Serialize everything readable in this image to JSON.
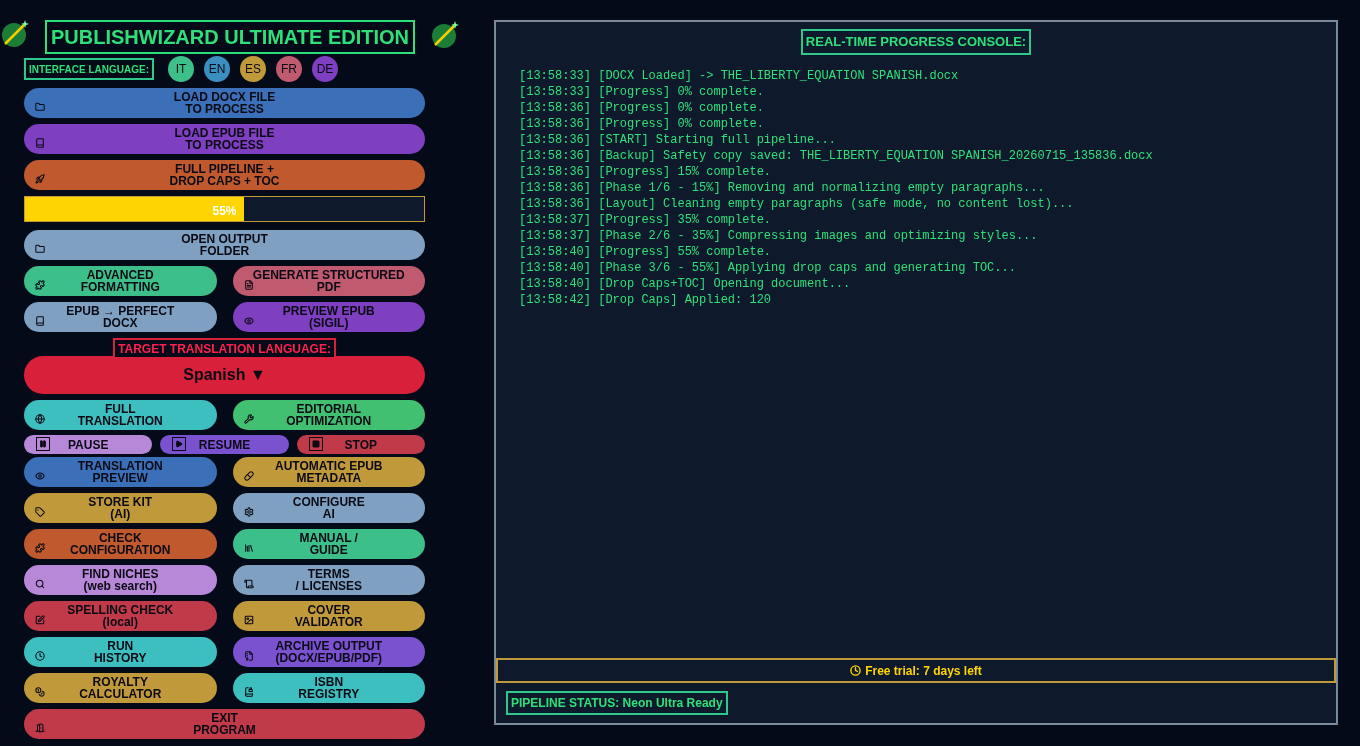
{
  "header": {
    "title": "PUBLISHWIZARD ULTIMATE EDITION",
    "language_label": "INTERFACE LANGUAGE:",
    "languages": [
      {
        "code": "IT",
        "color": "#3dbf8a"
      },
      {
        "code": "EN",
        "color": "#3b8fc0"
      },
      {
        "code": "ES",
        "color": "#c09a3a"
      },
      {
        "code": "FR",
        "color": "#c05a6e"
      },
      {
        "code": "DE",
        "color": "#7e3fc0"
      }
    ]
  },
  "rows": [
    {
      "kind": "buttons",
      "buttons": [
        {
          "label": "LOAD DOCX FILE\nTO PROCESS",
          "color": "#3b6fb8"
        }
      ]
    },
    {
      "kind": "buttons",
      "buttons": [
        {
          "label": "LOAD EPUB FILE\nTO PROCESS",
          "color": "#7e3fc0"
        }
      ]
    },
    {
      "kind": "buttons",
      "buttons": [
        {
          "label": "FULL PIPELINE +\nDROP CAPS + TOC",
          "color": "#c05a2e"
        }
      ]
    },
    {
      "kind": "progress",
      "level": 0.55,
      "text": "55%"
    },
    {
      "kind": "buttons",
      "buttons": [
        {
          "label": "OPEN OUTPUT\nFOLDER",
          "color": "#7fa0c0"
        }
      ]
    },
    {
      "kind": "buttons",
      "buttons": [
        {
          "label": "ADVANCED\nFORMATTING",
          "color": "#3dbf8a"
        },
        {
          "label": "GENERATE STRUCTURED\nPDF",
          "color": "#c05a6e"
        }
      ]
    },
    {
      "kind": "buttons",
      "buttons": [
        {
          "label": "EPUB → PERFECT\nDOCX",
          "color": "#7fa0c0"
        },
        {
          "label": "PREVIEW EPUB\n(SIGIL)",
          "color": "#7e3fc0"
        }
      ]
    },
    {
      "kind": "label",
      "text": "TARGET TRANSLATION LANGUAGE:"
    },
    {
      "kind": "select",
      "value": "Spanish",
      "caret": "▼"
    },
    {
      "kind": "buttons",
      "buttons": [
        {
          "label": "FULL\nTRANSLATION",
          "color": "#3dbfc0"
        },
        {
          "label": "EDITORIAL\nOPTIMIZATION",
          "color": "#40c070"
        }
      ]
    },
    {
      "kind": "controls",
      "buttons": [
        {
          "label": "PAUSE",
          "color": "#b888d8"
        },
        {
          "label": "RESUME",
          "color": "#7a52d0"
        },
        {
          "label": "STOP",
          "color": "#c03a4a"
        }
      ]
    },
    {
      "kind": "buttons",
      "buttons": [
        {
          "label": "TRANSLATION\nPREVIEW",
          "color": "#3b6fb8"
        },
        {
          "label": "AUTOMATIC EPUB\nMETADATA",
          "color": "#c09a3a"
        }
      ]
    },
    {
      "kind": "buttons",
      "buttons": [
        {
          "label": "STORE KIT\n(AI)",
          "color": "#c09a3a"
        },
        {
          "label": "CONFIGURE\nAI",
          "color": "#7fa0c0"
        }
      ]
    },
    {
      "kind": "buttons",
      "buttons": [
        {
          "label": "CHECK\nCONFIGURATION",
          "color": "#c05a2e"
        },
        {
          "label": "MANUAL /\nGUIDE",
          "color": "#3dbf8a"
        }
      ]
    },
    {
      "kind": "buttons",
      "buttons": [
        {
          "label": "FIND NICHES\n(web search)",
          "color": "#b888d8"
        },
        {
          "label": "TERMS\n/ LICENSES",
          "color": "#7fa0c0"
        }
      ]
    },
    {
      "kind": "buttons",
      "buttons": [
        {
          "label": "SPELLING CHECK\n(local)",
          "color": "#c03a4a"
        },
        {
          "label": "COVER\nVALIDATOR",
          "color": "#c09a3a"
        }
      ]
    },
    {
      "kind": "buttons",
      "buttons": [
        {
          "label": "RUN\nHISTORY",
          "color": "#3dbfc0"
        },
        {
          "label": "ARCHIVE OUTPUT\n(DOCX/EPUB/PDF)",
          "color": "#7a52d0"
        }
      ]
    },
    {
      "kind": "buttons",
      "buttons": [
        {
          "label": "ROYALTY\nCALCULATOR",
          "color": "#c09a3a"
        },
        {
          "label": "ISBN\nREGISTRY",
          "color": "#3dbfc0"
        }
      ]
    },
    {
      "kind": "buttons",
      "buttons": [
        {
          "label": "EXIT\nPROGRAM",
          "color": "#c03a4a"
        }
      ]
    }
  ],
  "console": {
    "title": "REAL-TIME PROGRESS CONSOLE:",
    "lines": [
      "[13:58:33] [DOCX Loaded] -> THE_LIBERTY_EQUATION SPANISH.docx",
      "[13:58:33] [Progress] 0% complete.",
      "[13:58:36] [Progress] 0% complete.",
      "[13:58:36] [Progress] 0% complete.",
      "[13:58:36] [START] Starting full pipeline...",
      "[13:58:36] [Backup] Safety copy saved: THE_LIBERTY_EQUATION SPANISH_20260715_135836.docx",
      "[13:58:36] [Progress] 15% complete.",
      "[13:58:36] [Phase 1/6 - 15%] Removing and normalizing empty paragraphs...",
      "[13:58:36] [Layout] Cleaning empty paragraphs (safe mode, no content lost)...",
      "[13:58:37] [Progress] 35% complete.",
      "[13:58:37] [Phase 2/6 - 35%] Compressing images and optimizing styles...",
      "[13:58:40] [Progress] 55% complete.",
      "[13:58:40] [Phase 3/6 - 55%] Applying drop caps and generating TOC...",
      "[13:58:40] [Drop Caps+TOC] Opening document...",
      "[13:58:42] [Drop Caps] Applied: 120"
    ]
  },
  "trial": "Free trial: 7 days left",
  "status": "PIPELINE STATUS: Neon Ultra Ready"
}
